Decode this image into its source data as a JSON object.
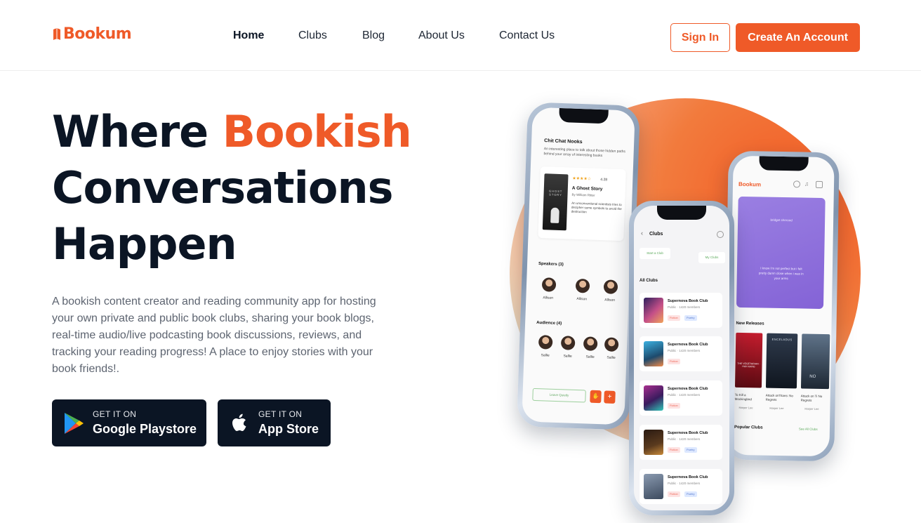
{
  "brand": {
    "name": "Bookum",
    "accent_color": "#ef5a28",
    "dark_color": "#0b1524"
  },
  "nav": {
    "items": [
      "Home",
      "Clubs",
      "Blog",
      "About Us",
      "Contact Us"
    ],
    "active": "Home"
  },
  "header": {
    "signin_label": "Sign In",
    "create_label": "Create An Account"
  },
  "hero": {
    "title_part1": "Where ",
    "title_accent": "Bookish",
    "title_line2": "Conversations",
    "title_line3": "Happen",
    "description": "A bookish content creator and reading community app for hosting your own private and public book clubs, sharing your book blogs, real-time audio/live podcasting book discussions, reviews, and tracking your reading progress! A place to enjoy stories with your book friends!."
  },
  "stores": {
    "google": {
      "small": "GET IT ON",
      "big": "Google Playstore",
      "icon": "google-play-icon"
    },
    "apple": {
      "small": "GET IT ON",
      "big": "App Store",
      "icon": "apple-icon"
    }
  },
  "phone_left": {
    "room_title": "Chit Chat Nooks",
    "room_desc": "An interesting place to talk about those hidden paths behind your array of interesting books",
    "book_title": "A Ghost Story",
    "book_author": "By William Ritter",
    "book_rating": "4.28",
    "book_blurb": "An unconventional scientists tries to decipher some symbols to avoid the destruction",
    "cover_text": "GHOST STORY",
    "speakers_label": "Speakers (3)",
    "speakers": [
      "Allison",
      "Allison",
      "Allison"
    ],
    "audience_label": "Audience (4)",
    "audience": [
      "Sallie",
      "Sallie",
      "Sallie",
      "Sallie"
    ],
    "leave_label": "Leave Quietly",
    "hand_icon": "raise-hand-icon",
    "plus_icon": "plus-icon"
  },
  "phone_middle": {
    "title": "Clubs",
    "start_label": "Start a Club",
    "my_clubs_label": "My Clubs",
    "all_clubs_label": "All Clubs",
    "clubs": [
      {
        "name": "Supernova Book Club",
        "meta": "Public · 1420 members",
        "tag1": "Fiction",
        "tag2": "Poetry"
      },
      {
        "name": "Supernova Book Club",
        "meta": "Public · 1420 members",
        "tag1": "Fiction",
        "tag2": ""
      },
      {
        "name": "Supernova Book Club",
        "meta": "Public · 1420 members",
        "tag1": "Fiction",
        "tag2": ""
      },
      {
        "name": "Supernova Book Club",
        "meta": "Public · 1420 members",
        "tag1": "Fiction",
        "tag2": "Poetry"
      },
      {
        "name": "Supernova Book Club",
        "meta": "Public · 1420 members",
        "tag1": "Fiction",
        "tag2": "Poetry"
      }
    ]
  },
  "phone_right": {
    "logo": "Bookum",
    "banner_top": "bridget sherood",
    "banner_quote": "I know i'm not perfect but i felt pretty damn close when i was in your arms",
    "new_releases_label": "New Releases",
    "books": [
      {
        "title": "To Kill a Mockingbird",
        "author": "Harper Lee",
        "cover": "THE VEGETARIAN · HAN KANG"
      },
      {
        "title": "Attack onTitans: No Regrets",
        "author": "Harper Lee",
        "cover": "ENCELADUS"
      },
      {
        "title": "Attack on Ti No Regrets",
        "author": "Harper Lee",
        "cover": "NO"
      }
    ],
    "popular_label": "Popular Clubs",
    "see_all_label": "See All Clubs"
  }
}
